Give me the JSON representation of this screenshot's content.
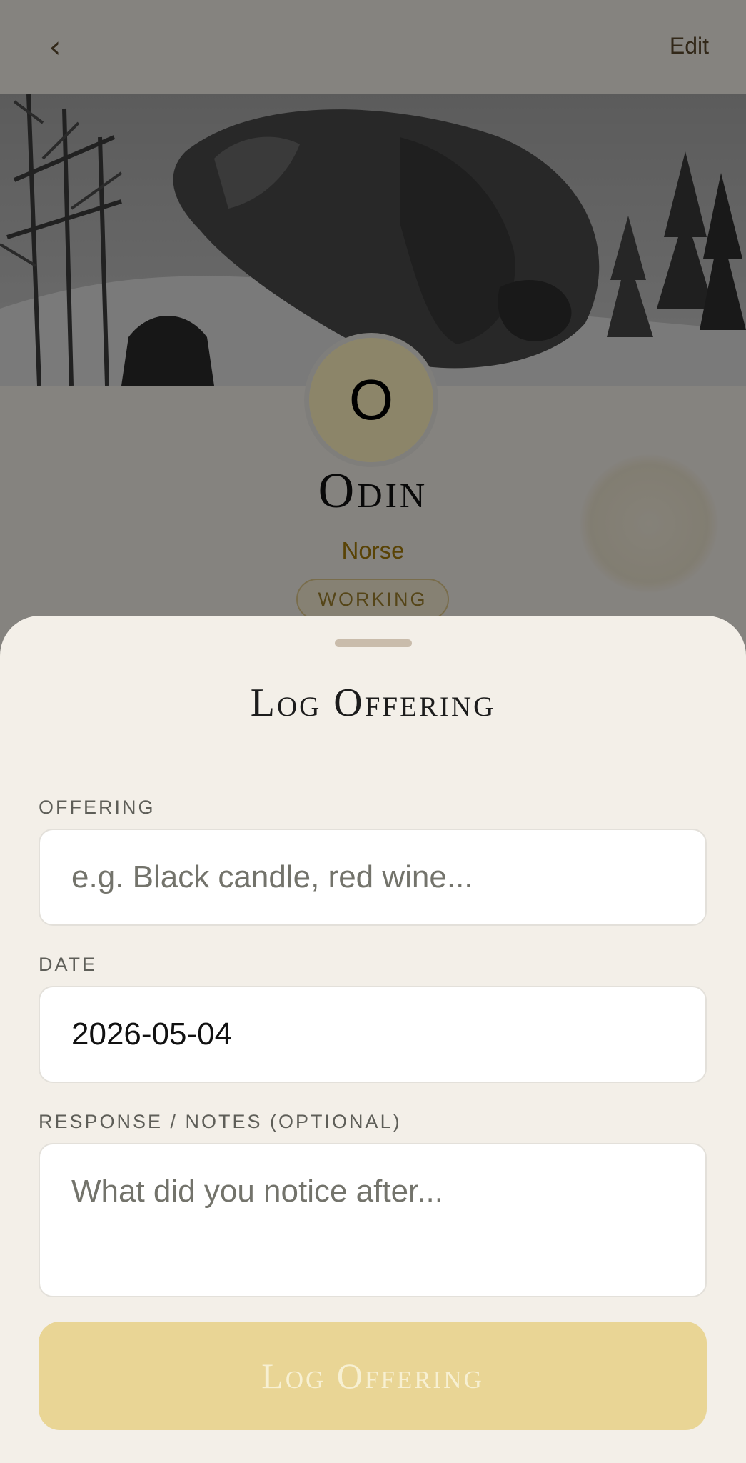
{
  "header": {
    "back_icon": "chevron-left-icon",
    "back_glyph": "‹",
    "edit_label": "Edit"
  },
  "deity": {
    "initial": "O",
    "name": "Odin",
    "pantheon": "Norse",
    "status": "WORKING"
  },
  "sheet": {
    "title": "Log Offering",
    "offering": {
      "label": "OFFERING",
      "placeholder": "e.g. Black candle, red wine...",
      "value": ""
    },
    "date": {
      "label": "DATE",
      "value": "2026-05-04"
    },
    "notes": {
      "label": "RESPONSE / NOTES (OPTIONAL)",
      "placeholder": "What did you notice after...",
      "value": ""
    },
    "submit_label": "Log Offering"
  },
  "colors": {
    "accent_gold": "#a27a0c",
    "sheet_background": "#f3efe8",
    "submit_disabled": "#e9d595",
    "scrim": "rgba(0,0,0,0.45)"
  }
}
